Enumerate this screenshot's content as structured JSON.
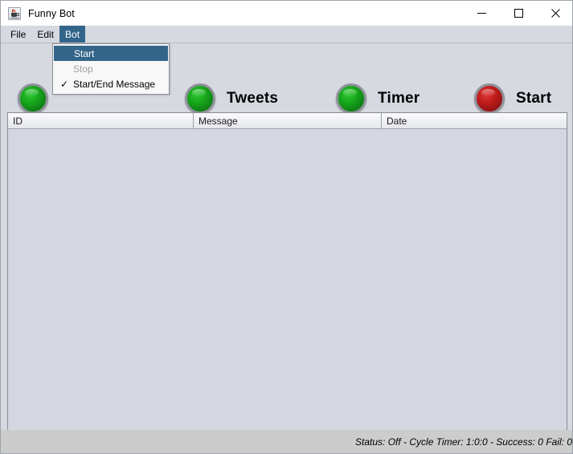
{
  "window": {
    "title": "Funny Bot",
    "icon": "java-coffee-cup-icon",
    "controls": {
      "minimize": "minimize-icon",
      "maximize": "maximize-icon",
      "close": "close-icon"
    }
  },
  "menubar": {
    "items": [
      {
        "label": "File",
        "active": false
      },
      {
        "label": "Edit",
        "active": false
      },
      {
        "label": "Bot",
        "active": true
      }
    ]
  },
  "dropdown": {
    "open_for": "Bot",
    "items": [
      {
        "label": "Start",
        "state": "highlighted",
        "checked": false
      },
      {
        "label": "Stop",
        "state": "disabled",
        "checked": false
      },
      {
        "label": "Start/End Message",
        "state": "normal",
        "checked": true
      }
    ],
    "check_glyph": "✓"
  },
  "toolbar": {
    "indicators": [
      {
        "label": "",
        "color": "green",
        "color_hex": "#18a81c",
        "name": "status-led"
      },
      {
        "label": "Tweets",
        "color": "green",
        "color_hex": "#18a81c",
        "name": "tweets-led"
      },
      {
        "label": "Timer",
        "color": "green",
        "color_hex": "#18a81c",
        "name": "timer-led"
      },
      {
        "label": "Start",
        "color": "red",
        "color_hex": "#c11d1d",
        "name": "start-led"
      }
    ]
  },
  "table": {
    "columns": [
      "ID",
      "Message",
      "Date"
    ],
    "rows": []
  },
  "statusbar": {
    "text": "Status: Off - Cycle Timer: 1:0:0 - Success: 0 Fail: 0"
  },
  "colors": {
    "window_background": "#d6d9e0",
    "table_background": "#d4d7e0",
    "menu_highlight": "#33658a",
    "statusbar_background": "#cccccc"
  }
}
